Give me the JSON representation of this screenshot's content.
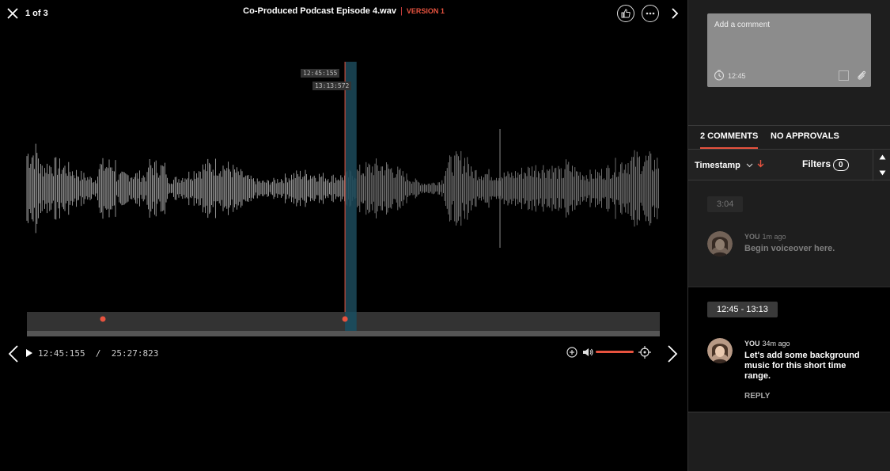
{
  "header": {
    "counter": "1 of 3",
    "title": "Co-Produced Podcast Episode 4.wav",
    "separator": "|",
    "version": "VERSION 1"
  },
  "player": {
    "selection_start_tag": "12:45:155",
    "selection_end_tag": "13:13:572",
    "current_time": "12:45:155",
    "time_separator": "/",
    "duration": "25:27:823",
    "playhead_fraction": 0.5026,
    "selection_end_fraction": 0.5209,
    "comment_marker_fractions": [
      0.12,
      0.5026
    ],
    "volume_level": 1.0,
    "accent_color": "#e8533f",
    "selection_color": "#1c4a5a"
  },
  "composer": {
    "placeholder": "Add a comment",
    "timestamp": "12:45"
  },
  "tabs": {
    "comments": "2 COMMENTS",
    "approvals": "NO APPROVALS"
  },
  "sortbar": {
    "sort_label": "Timestamp",
    "filters_label": "Filters",
    "filters_count": "0"
  },
  "comments": [
    {
      "range": "3:04",
      "author": "YOU",
      "ago": "1m ago",
      "text": "Begin voiceover here."
    },
    {
      "range": "12:45 - 13:13",
      "author": "YOU",
      "ago": "34m ago",
      "text": "Let's add some background music for this short time range.",
      "reply": "REPLY"
    }
  ],
  "icons": [
    "close-icon",
    "thumbs-up-icon",
    "more-icon",
    "chevron-right-icon",
    "chevron-left-icon",
    "play-icon",
    "zoom-in-icon",
    "volume-icon",
    "crosshair-icon",
    "clock-icon",
    "checkbox-icon",
    "paperclip-icon",
    "chevron-down-icon",
    "arrow-down-icon",
    "triangle-up-icon",
    "triangle-down-icon"
  ]
}
